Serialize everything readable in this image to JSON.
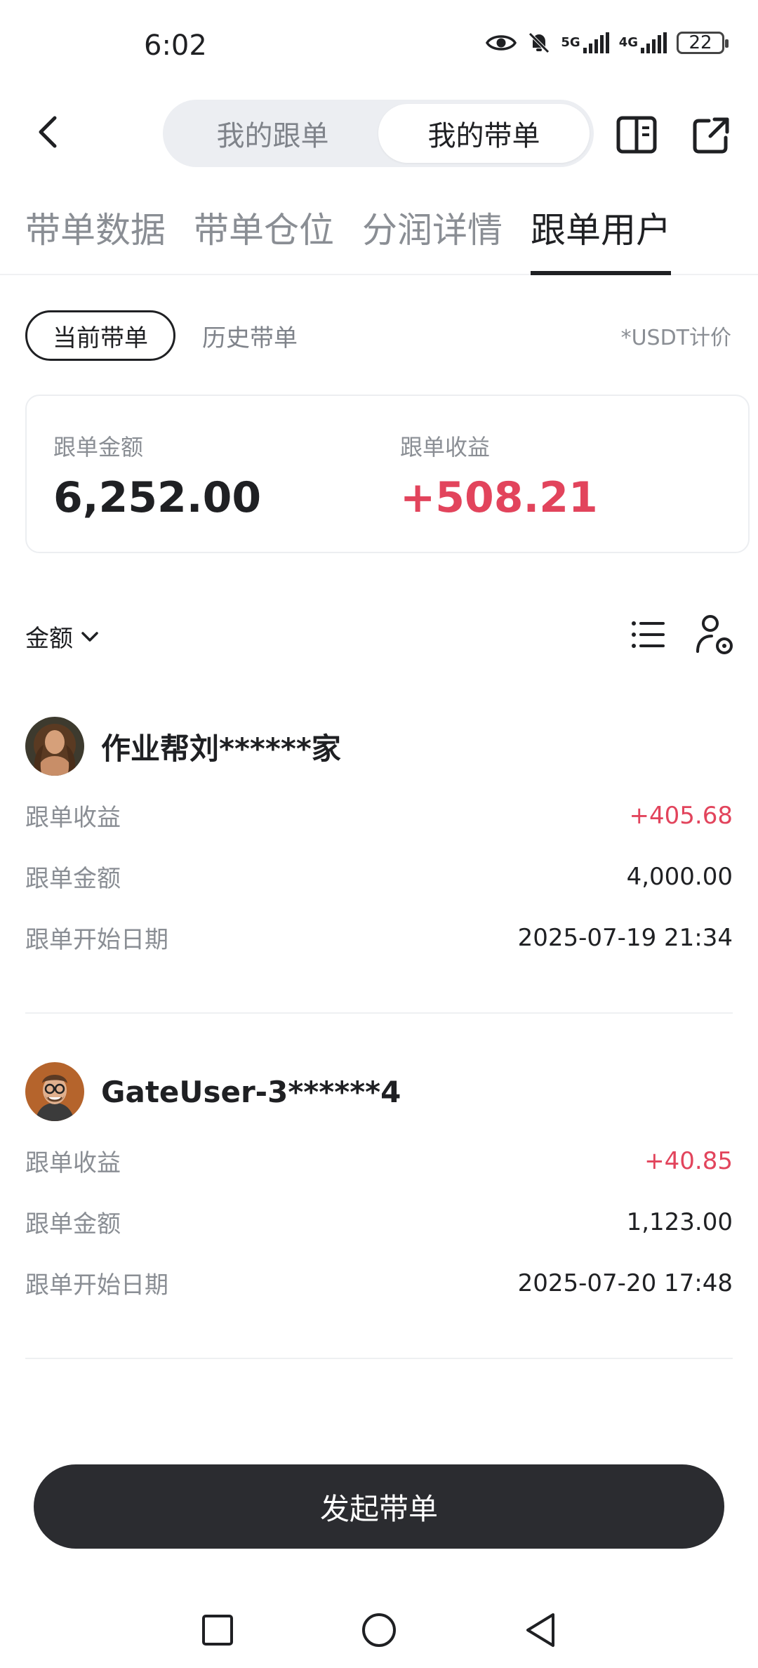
{
  "status_bar": {
    "time": "6:02",
    "network_1": "5G",
    "network_2": "4G",
    "battery": "22"
  },
  "header": {
    "segments": [
      "我的跟单",
      "我的带单"
    ],
    "active_segment": 1
  },
  "tabs": [
    "带单数据",
    "带单仓位",
    "分润详情",
    "跟单用户"
  ],
  "active_tab": 3,
  "subfilters": {
    "current": "当前带单",
    "history": "历史带单",
    "note": "*USDT计价"
  },
  "summary": {
    "amount_label": "跟单金额",
    "amount_value": "6,252.00",
    "profit_label": "跟单收益",
    "profit_value": "+508.21"
  },
  "sort": {
    "label": "金额"
  },
  "users": [
    {
      "name": "作业帮刘******家",
      "profit_label": "跟单收益",
      "profit": "+405.68",
      "amount_label": "跟单金额",
      "amount": "4,000.00",
      "date_label": "跟单开始日期",
      "date": "2025-07-19 21:34"
    },
    {
      "name": "GateUser-3******4",
      "profit_label": "跟单收益",
      "profit": "+40.85",
      "amount_label": "跟单金额",
      "amount": "1,123.00",
      "date_label": "跟单开始日期",
      "date": "2025-07-20 17:48"
    }
  ],
  "cta": {
    "label": "发起带单"
  },
  "colors": {
    "positive": "#e2445c",
    "primary_text": "#1f2023",
    "secondary_text": "#8a8e94",
    "cta_bg": "#2b2c30"
  }
}
